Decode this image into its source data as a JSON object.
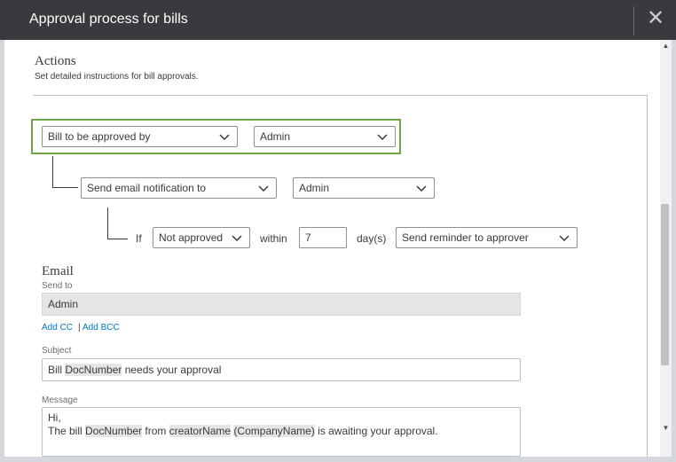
{
  "dialog": {
    "title": "Approval process for bills",
    "close_glyph": "✕"
  },
  "actions": {
    "title": "Actions",
    "description": "Set detailed instructions for bill approvals.",
    "rule1": {
      "action": "Bill to be approved by",
      "approver": "Admin"
    },
    "rule2": {
      "action": "Send email notification to",
      "recipient": "Admin"
    },
    "rule3": {
      "if_label": "If",
      "condition": "Not approved",
      "within_label": "within",
      "days_value": "7",
      "days_unit": "day(s)",
      "then_action": "Send reminder to approver"
    }
  },
  "email": {
    "title": "Email",
    "send_to_label": "Send to",
    "send_to_value": "Admin",
    "add_cc": "Add CC",
    "separator": "|",
    "add_bcc": "Add BCC",
    "subject_label": "Subject",
    "subject": {
      "prefix": "Bill ",
      "token": "DocNumber",
      "suffix": " needs your approval"
    },
    "message_label": "Message",
    "message": {
      "line1": "Hi,",
      "line2": {
        "part1": "The bill ",
        "token1": "DocNumber",
        "part2": " from ",
        "token2": "creatorName",
        "part3": " ",
        "token3": "(CompanyName)",
        "part4": " is awaiting your approval."
      }
    }
  },
  "colors": {
    "titlebar": "#393a3d",
    "highlight": "#6da542",
    "link": "#0077c5"
  },
  "icons": {
    "dropdown": "chevron-down-icon",
    "close": "close-icon"
  }
}
